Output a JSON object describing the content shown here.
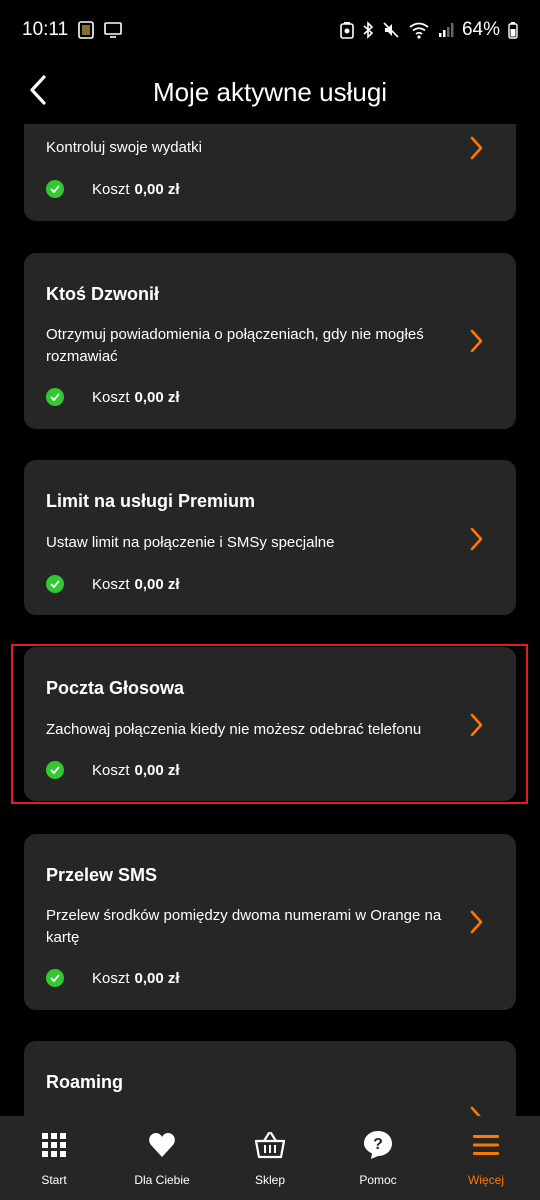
{
  "status_bar": {
    "time": "10:11",
    "battery": "64%"
  },
  "header": {
    "title": "Moje aktywne usługi"
  },
  "services": [
    {
      "title": "",
      "description": "Kontroluj swoje wydatki",
      "cost_label": "Koszt",
      "cost_value": "0,00 zł"
    },
    {
      "title": "Ktoś Dzwonił",
      "description": "Otrzymuj powiadomienia o połączeniach, gdy nie mogłeś rozmawiać",
      "cost_label": "Koszt",
      "cost_value": "0,00 zł"
    },
    {
      "title": "Limit na usługi Premium",
      "description": "Ustaw limit na połączenie i SMSy specjalne",
      "cost_label": "Koszt",
      "cost_value": "0,00 zł"
    },
    {
      "title": "Poczta Głosowa",
      "description": "Zachowaj połączenia kiedy nie możesz odebrać telefonu",
      "cost_label": "Koszt",
      "cost_value": "0,00 zł"
    },
    {
      "title": "Przelew SMS",
      "description": "Przelew środków pomiędzy dwoma numerami w Orange na kartę",
      "cost_label": "Koszt",
      "cost_value": "0,00 zł"
    },
    {
      "title": "Roaming",
      "description": "",
      "cost_label": "",
      "cost_value": ""
    }
  ],
  "bottom_nav": {
    "items": [
      {
        "label": "Start",
        "icon": "grid-icon"
      },
      {
        "label": "Dla Ciebie",
        "icon": "heart-icon"
      },
      {
        "label": "Sklep",
        "icon": "basket-icon"
      },
      {
        "label": "Pomoc",
        "icon": "help-icon"
      },
      {
        "label": "Więcej",
        "icon": "menu-icon",
        "active": true
      }
    ]
  },
  "colors": {
    "accent": "#ff7900",
    "card": "#262626",
    "check": "#32c832",
    "highlight": "#e31b23"
  }
}
